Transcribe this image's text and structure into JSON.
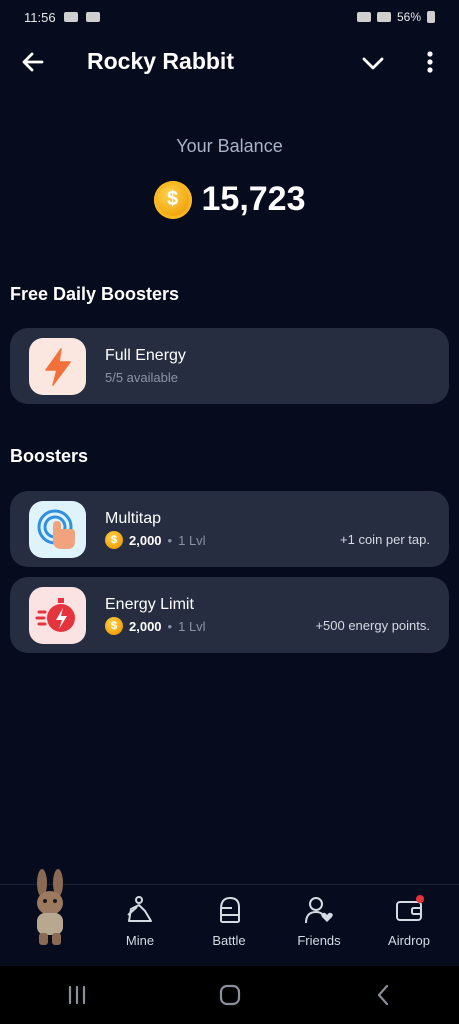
{
  "status_bar": {
    "time": "11:56",
    "battery": "56%"
  },
  "header": {
    "title": "Rocky Rabbit",
    "back_icon": "arrow-left-icon",
    "chevron_icon": "chevron-down-icon",
    "more_icon": "more-vertical-icon"
  },
  "balance": {
    "label": "Your Balance",
    "value": "15,723",
    "coin_symbol": "$"
  },
  "free_boosters": {
    "title": "Free Daily Boosters",
    "items": [
      {
        "title": "Full Energy",
        "subtitle": "5/5 available",
        "icon": "lightning-icon",
        "icon_bg": "#fbe7df",
        "icon_color": "#f2703a"
      }
    ]
  },
  "boosters": {
    "title": "Boosters",
    "items": [
      {
        "title": "Multitap",
        "price": "2,000",
        "level": "1 Lvl",
        "description": "+1 coin per tap.",
        "icon": "tap-finger-icon",
        "icon_bg": "#dff3fa",
        "coin_symbol": "$"
      },
      {
        "title": "Energy Limit",
        "price": "2,000",
        "level": "1 Lvl",
        "description": "+500 energy points.",
        "icon": "energy-timer-icon",
        "icon_bg": "#fbe3e4",
        "coin_symbol": "$"
      }
    ]
  },
  "separator": "•",
  "bottom_nav": {
    "items": [
      {
        "label": "Mine",
        "icon": "pickaxe-miner-icon"
      },
      {
        "label": "Battle",
        "icon": "boxing-glove-icon"
      },
      {
        "label": "Friends",
        "icon": "friends-heart-icon"
      },
      {
        "label": "Airdrop",
        "icon": "wallet-icon"
      }
    ],
    "notification_color": "#e5343e"
  },
  "colors": {
    "background": "#060b1d",
    "card": "#262d40",
    "muted_text": "#8b93a7",
    "coin": "#f0a20c"
  }
}
